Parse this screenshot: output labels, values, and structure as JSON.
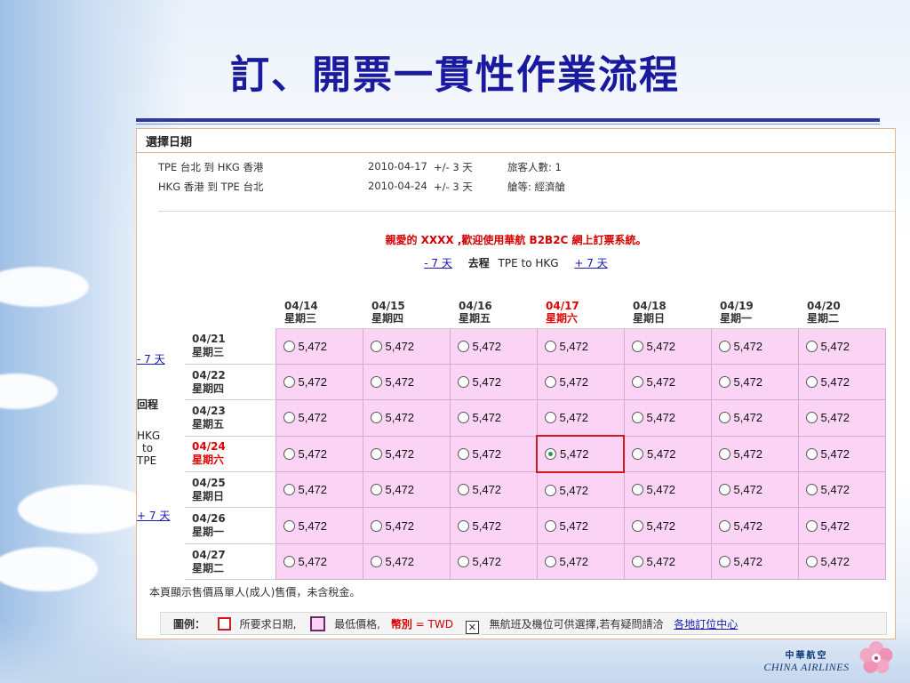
{
  "slide": {
    "title": "訂、開票一貫性作業流程"
  },
  "panel": {
    "header": "選擇日期",
    "trips": [
      {
        "route": "TPE 台北 到 HKG 香港",
        "date": "2010-04-17",
        "range": "+/- 3 天",
        "extra": "旅客人數: 1"
      },
      {
        "route": "HKG 香港 到 TPE 台北",
        "date": "2010-04-24",
        "range": "+/- 3 天",
        "extra": "艙等: 經濟艙"
      }
    ],
    "welcome": "親愛的 XXXX ,歡迎使用華航 B2B2C 網上訂票系統。",
    "outbound_nav": {
      "prev": "- 7 天",
      "label": "去程",
      "route": "TPE to HKG",
      "next": "+ 7 天"
    },
    "return_nav": {
      "prev": "- 7 天",
      "label": "回程",
      "route_lines": [
        "HKG",
        "to",
        "TPE"
      ],
      "next": "+ 7 天"
    },
    "columns": [
      {
        "date": "04/14",
        "weekday": "星期三",
        "selected": false
      },
      {
        "date": "04/15",
        "weekday": "星期四",
        "selected": false
      },
      {
        "date": "04/16",
        "weekday": "星期五",
        "selected": false
      },
      {
        "date": "04/17",
        "weekday": "星期六",
        "selected": true
      },
      {
        "date": "04/18",
        "weekday": "星期日",
        "selected": false
      },
      {
        "date": "04/19",
        "weekday": "星期一",
        "selected": false
      },
      {
        "date": "04/20",
        "weekday": "星期二",
        "selected": false
      }
    ],
    "rows": [
      {
        "date": "04/21",
        "weekday": "星期三",
        "selected": false,
        "prices": [
          "5,472",
          "5,472",
          "5,472",
          "5,472",
          "5,472",
          "5,472",
          "5,472"
        ]
      },
      {
        "date": "04/22",
        "weekday": "星期四",
        "selected": false,
        "prices": [
          "5,472",
          "5,472",
          "5,472",
          "5,472",
          "5,472",
          "5,472",
          "5,472"
        ]
      },
      {
        "date": "04/23",
        "weekday": "星期五",
        "selected": false,
        "prices": [
          "5,472",
          "5,472",
          "5,472",
          "5,472",
          "5,472",
          "5,472",
          "5,472"
        ]
      },
      {
        "date": "04/24",
        "weekday": "星期六",
        "selected": true,
        "prices": [
          "5,472",
          "5,472",
          "5,472",
          "5,472",
          "5,472",
          "5,472",
          "5,472"
        ]
      },
      {
        "date": "04/25",
        "weekday": "星期日",
        "selected": false,
        "prices": [
          "5,472",
          "5,472",
          "5,472",
          "5,472",
          "5,472",
          "5,472",
          "5,472"
        ]
      },
      {
        "date": "04/26",
        "weekday": "星期一",
        "selected": false,
        "prices": [
          "5,472",
          "5,472",
          "5,472",
          "5,472",
          "5,472",
          "5,472",
          "5,472"
        ]
      },
      {
        "date": "04/27",
        "weekday": "星期二",
        "selected": false,
        "prices": [
          "5,472",
          "5,472",
          "5,472",
          "5,472",
          "5,472",
          "5,472",
          "5,472"
        ]
      }
    ],
    "selected_cell": {
      "row": 3,
      "col": 3
    },
    "note": "本頁顯示售價爲單人(成人)售價，未含稅金。",
    "legend": {
      "title": "圖例：",
      "requested_date": "所要求日期,",
      "lowest_price": "最低價格,",
      "currency_label": "幣別",
      "currency_value": "= TWD",
      "no_flight_symbol": "✕",
      "no_flight": "無航班及機位可供選擇,若有疑問請洽",
      "link": "各地訂位中心"
    }
  },
  "branding": {
    "cn": "中華航空",
    "en": "CHINA AIRLINES"
  },
  "colors": {
    "title": "#1a1a9e",
    "cell": "#fbd4f5",
    "selected": "#d21a1a",
    "link": "#1a1ab0"
  }
}
